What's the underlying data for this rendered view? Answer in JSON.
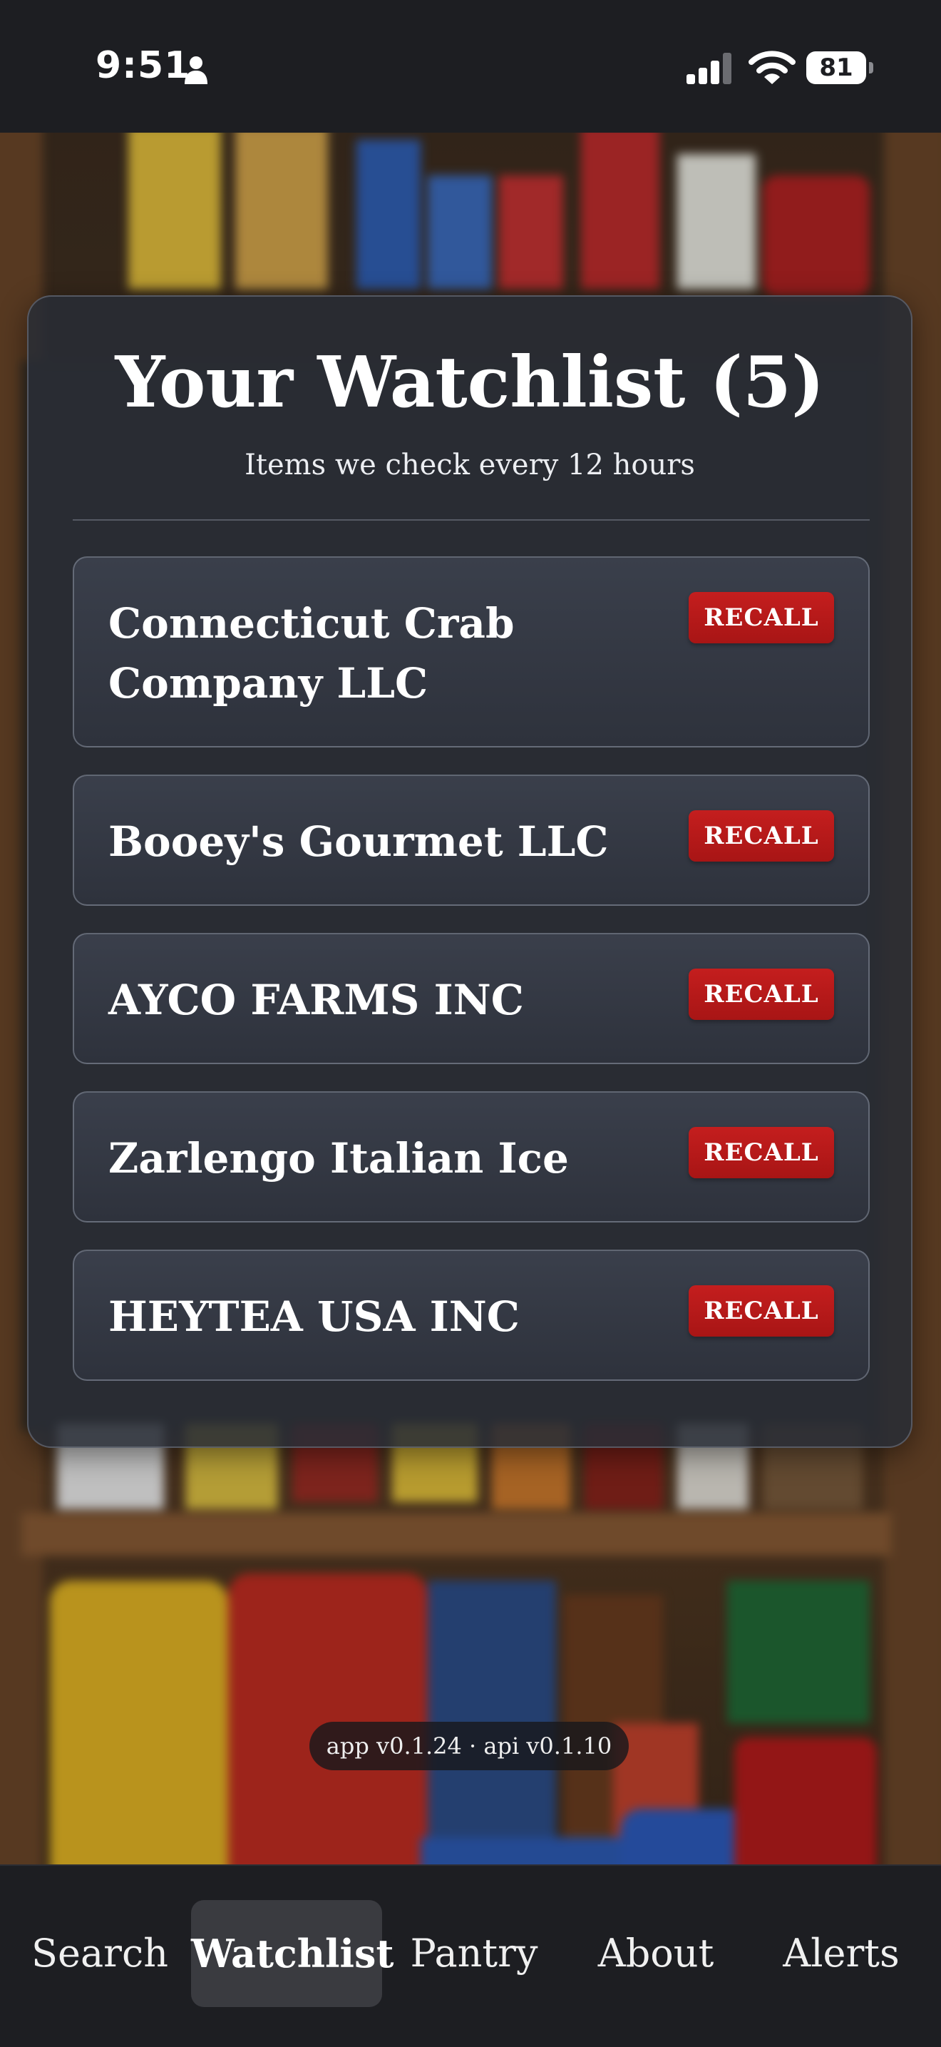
{
  "status_bar": {
    "time": "9:51",
    "battery": "81",
    "icons": [
      "person-icon",
      "signal-icon",
      "wifi-icon",
      "battery-icon"
    ]
  },
  "background": {
    "description_icon": "pantry-photo-blurred"
  },
  "watchlist": {
    "title": "Your Watchlist (5)",
    "subtitle": "Items we check every 12 hours",
    "items": [
      {
        "name": "Connecticut Crab Company LLC",
        "badge": "RECALL"
      },
      {
        "name": "Booey's Gourmet LLC",
        "badge": "RECALL"
      },
      {
        "name": "AYCO FARMS INC",
        "badge": "RECALL"
      },
      {
        "name": "Zarlengo Italian Ice",
        "badge": "RECALL"
      },
      {
        "name": "HEYTEA USA INC",
        "badge": "RECALL"
      }
    ]
  },
  "version": "app v0.1.24 · api v0.1.10",
  "tabs": [
    {
      "label": "Search",
      "active": false
    },
    {
      "label": "Watchlist",
      "active": true
    },
    {
      "label": "Pantry",
      "active": false
    },
    {
      "label": "About",
      "active": false
    },
    {
      "label": "Alerts",
      "active": false
    }
  ],
  "colors": {
    "recall_badge": "#b81a1a",
    "card_background": "#2b2f38",
    "tab_bar": "#1d1e22",
    "active_tab": "#3a3b40"
  }
}
